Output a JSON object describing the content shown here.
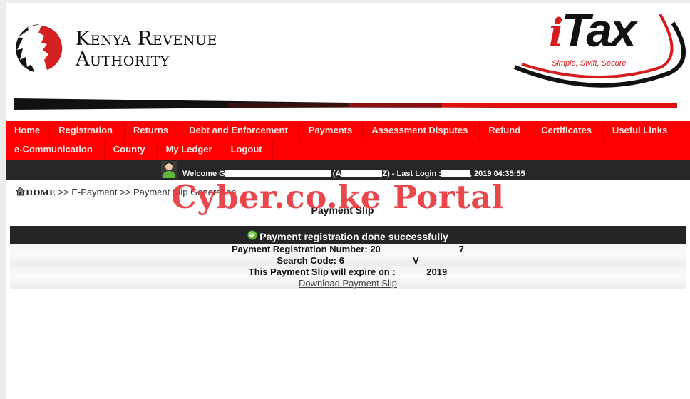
{
  "header": {
    "kra_line1": "Kenya Revenue",
    "kra_line2": "Authority",
    "itax_i": "i",
    "itax_word": "Tax",
    "itax_tagline": "Simple, Swift, Secure",
    "colors": {
      "brand_red": "#fe0000",
      "dark_bar": "#262626"
    }
  },
  "menu": {
    "row1": [
      "Home",
      "Registration",
      "Returns",
      "Debt and Enforcement",
      "Payments",
      "Assessment Disputes",
      "Refund",
      "Certificates",
      "Useful Links"
    ],
    "row2": [
      "e-Communication",
      "County",
      "My Ledger",
      "Logout"
    ]
  },
  "welcome": {
    "prefix": "Welcome G",
    "pin_open": "(A",
    "pin_close": "Z)",
    "last_login_label": "- Last Login :",
    "last_login_tail": ", 2019 04:35:55"
  },
  "breadcrumb": {
    "home": "HOME",
    "sep": ">>",
    "items": [
      "E-Payment",
      "Payment Slip Generation"
    ]
  },
  "watermark": "Cyber.co.ke Portal",
  "page_title": "Payment Slip",
  "result": {
    "message": "Payment registration done successfully",
    "reg_number_label": "Payment Registration Number:",
    "reg_number_start": "20",
    "reg_number_end": "7",
    "search_code_label": "Search Code:",
    "search_code_start": "6",
    "search_code_end": "V",
    "expiry_label": "This Payment Slip will expire on :",
    "expiry_end": "2019",
    "download_link": "Download Payment Slip"
  }
}
